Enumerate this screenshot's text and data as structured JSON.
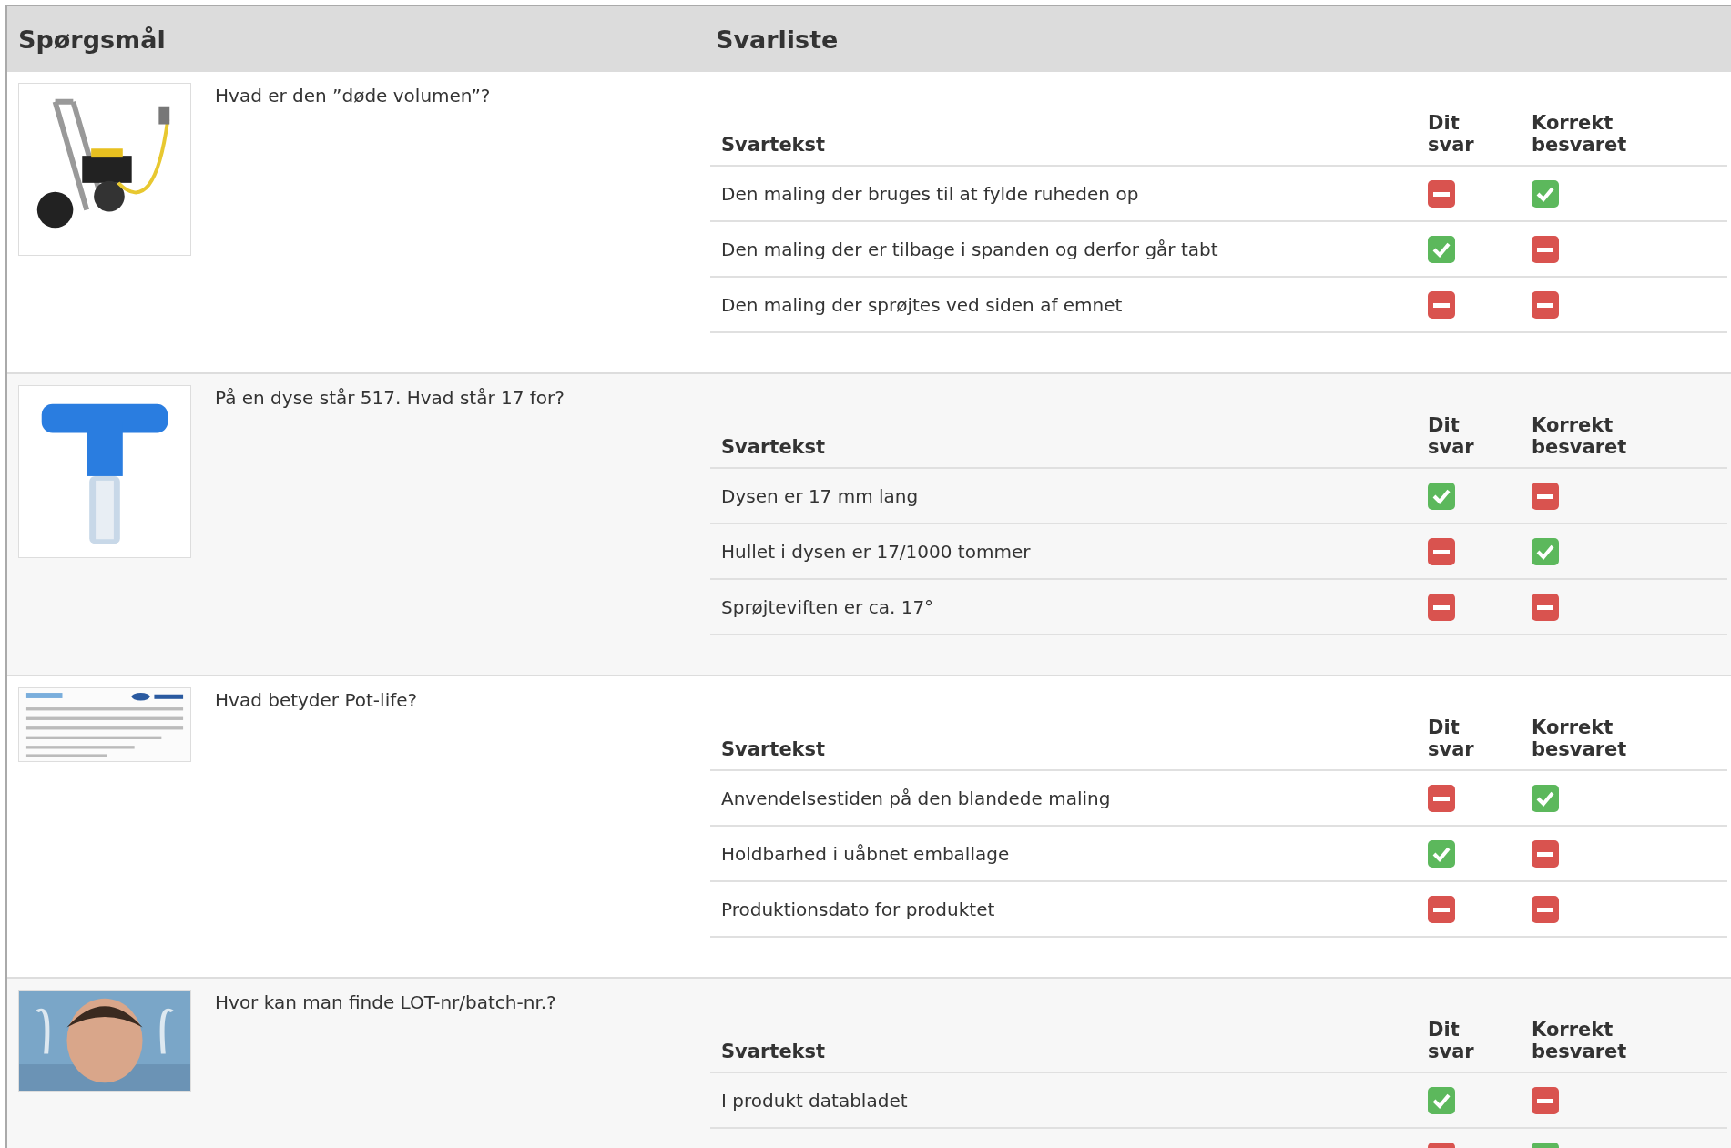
{
  "header": {
    "question_column": "Spørgsmål",
    "answers_column": "Svarliste"
  },
  "questions": [
    {
      "text": "Hvad er den ”døde volumen”?",
      "picture": {
        "kind": "picture"
      },
      "answer_header": {
        "text": "Svartekst",
        "your": "Dit svar",
        "correct": "Korrekt besvaret"
      },
      "answers": [
        {
          "text": "Den maling der bruges til at fylde ruheden op",
          "your": false,
          "correct": true
        },
        {
          "text": "Den maling der er tilbage i spanden og derfor går tabt",
          "your": true,
          "correct": false
        },
        {
          "text": "Den maling der sprøjtes ved siden af emnet",
          "your": false,
          "correct": false
        }
      ]
    },
    {
      "text": "På en dyse står 517. Hvad står 17 for?",
      "picture": {
        "kind": "picture"
      },
      "answer_header": {
        "text": "Svartekst",
        "your": "Dit svar",
        "correct": "Korrekt besvaret"
      },
      "answers": [
        {
          "text": "Dysen er 17 mm lang",
          "your": true,
          "correct": false
        },
        {
          "text": "Hullet i dysen er 17/1000 tommer",
          "your": false,
          "correct": true
        },
        {
          "text": "Sprøjteviften er ca. 17°",
          "your": false,
          "correct": false
        }
      ]
    },
    {
      "text": "Hvad betyder Pot-life?",
      "picture": {
        "kind": "picture"
      },
      "answer_header": {
        "text": "Svartekst",
        "your": "Dit svar",
        "correct": "Korrekt besvaret"
      },
      "answers": [
        {
          "text": "Anvendelsestiden på den blandede maling",
          "your": false,
          "correct": true
        },
        {
          "text": "Holdbarhed i uåbnet emballage",
          "your": true,
          "correct": false
        },
        {
          "text": "Produktionsdato for produktet",
          "your": false,
          "correct": false
        }
      ]
    },
    {
      "text": "Hvor kan man finde LOT-nr/batch-nr.?",
      "picture": {
        "kind": "picture"
      },
      "answer_header": {
        "text": "Svartekst",
        "your": "Dit svar",
        "correct": "Korrekt besvaret"
      },
      "answers": [
        {
          "text": "I produkt databladet",
          "your": true,
          "correct": false
        },
        {
          "your": false,
          "correct": true
        }
      ]
    }
  ]
}
